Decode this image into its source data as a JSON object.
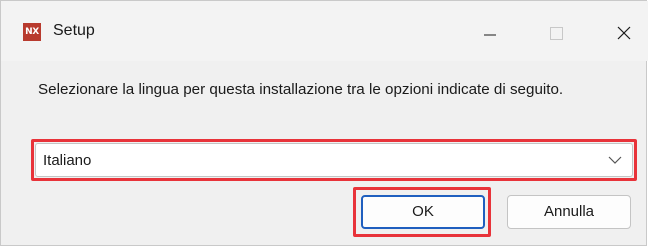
{
  "window": {
    "title": "Setup",
    "app_icon_text": "NX",
    "controls": {
      "minimize": "minimize-icon",
      "maximize": "maximize-icon",
      "close": "close-icon"
    }
  },
  "dialog": {
    "prompt": "Selezionare la lingua per questa installazione tra le opzioni indicate di seguito.",
    "language_select": {
      "selected": "Italiano",
      "icon": "chevron-down-icon"
    },
    "buttons": {
      "ok_label": "OK",
      "cancel_label": "Annulla"
    }
  },
  "colors": {
    "highlight": "#e8333a",
    "focus_border": "#1f5fbf",
    "app_icon": "#b83a2e"
  }
}
